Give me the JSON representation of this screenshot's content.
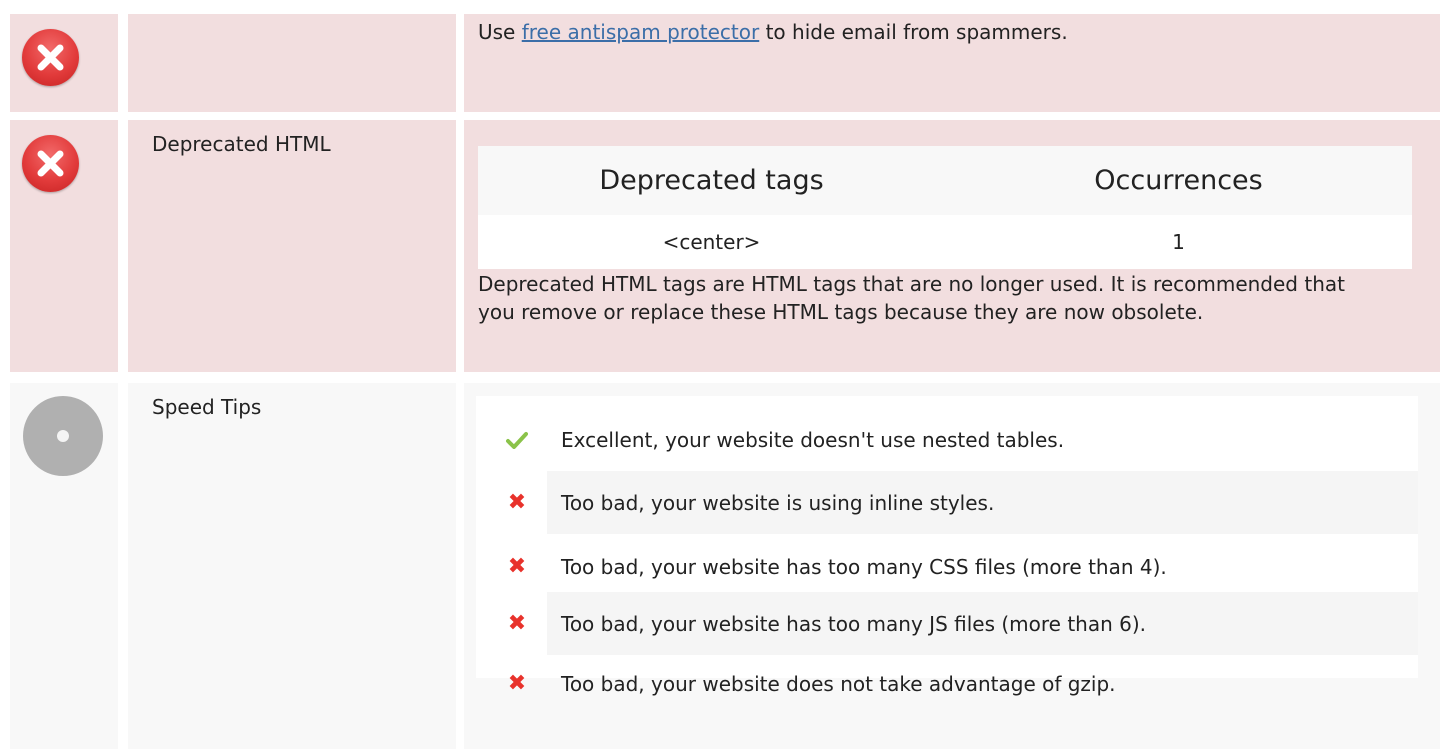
{
  "email_row": {
    "label": "",
    "text_before": "Use ",
    "link_text": "free antispam protector",
    "text_after": " to hide email from spammers.",
    "status_icon": "error-icon"
  },
  "deprecated_row": {
    "label": "Deprecated HTML",
    "status_icon": "error-icon",
    "table": {
      "headers": [
        "Deprecated tags",
        "Occurrences"
      ],
      "rows": [
        [
          "<center>",
          "1"
        ]
      ]
    },
    "description": "Deprecated HTML tags are HTML tags that are no longer used. It is recommended that you remove or replace these HTML tags because they are now obsolete."
  },
  "speed_row": {
    "label": "Speed Tips",
    "status_icon": "neutral-icon",
    "tips": [
      {
        "icon": "check-icon",
        "text": "Excellent, your website doesn't use nested tables."
      },
      {
        "icon": "cross-icon",
        "text": "Too bad, your website is using inline styles."
      },
      {
        "icon": "cross-icon",
        "text": "Too bad, your website has too many CSS files (more than 4)."
      },
      {
        "icon": "cross-icon",
        "text": "Too bad, your website has too many JS files (more than 6)."
      },
      {
        "icon": "cross-icon",
        "text": "Too bad, your website does not take advantage of gzip."
      }
    ]
  },
  "colors": {
    "error_bg": "#f2dedf",
    "neutral_bg": "#f8f8f8",
    "error_icon": "#e23b3b",
    "check": "#8bc34a",
    "cross": "#e8322b",
    "link": "#3b6ea8"
  }
}
